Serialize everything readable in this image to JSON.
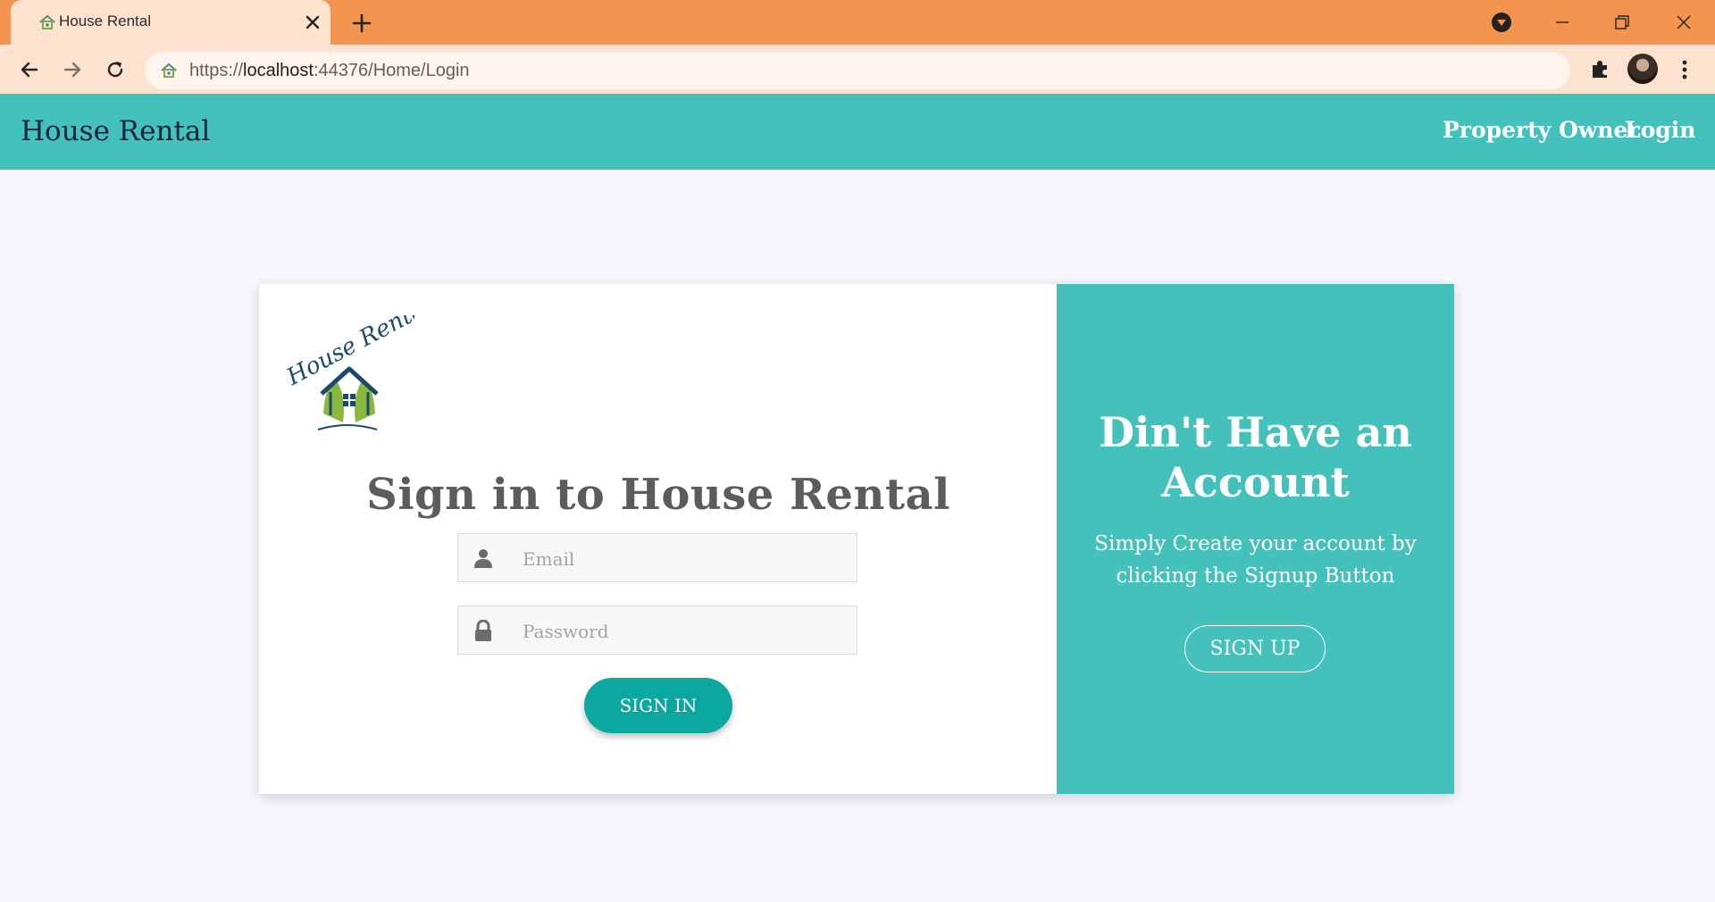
{
  "browser": {
    "tab_title": "House Rental",
    "url_prefix": "https://",
    "url_host": "localhost",
    "url_rest": ":44376/Home/Login"
  },
  "site": {
    "brand": "House Rental",
    "nav": {
      "property_owner": "Property Owner",
      "login": "Login"
    }
  },
  "login": {
    "logo_text": "House Rental",
    "title": "Sign in to House Rental",
    "email_placeholder": "Email",
    "password_placeholder": "Password",
    "signin_button": "SIGN IN"
  },
  "signup_panel": {
    "title": "Din't Have an Account",
    "text": "Simply Create your account by clicking the Signup Button",
    "button": "SIGN UP"
  },
  "colors": {
    "chrome": "#f3954e",
    "teal": "#44c1ba",
    "button_teal": "#0aa89e",
    "page_bg": "#f6f7fd"
  },
  "icons": [
    "house-favicon-icon",
    "close-icon",
    "plus-icon",
    "media-icon",
    "minimize-icon",
    "restore-icon",
    "window-close-icon",
    "back-arrow-icon",
    "forward-arrow-icon",
    "reload-icon",
    "puzzle-icon",
    "kebab-menu-icon",
    "user-icon",
    "lock-icon"
  ]
}
